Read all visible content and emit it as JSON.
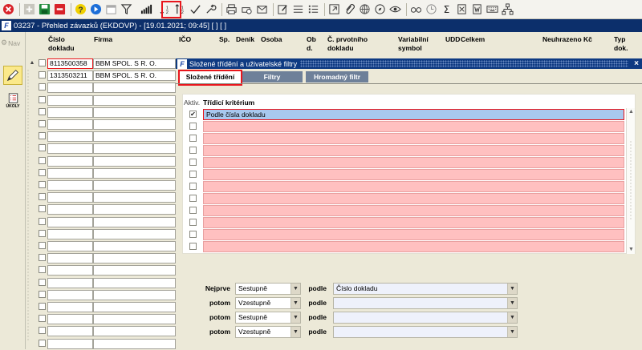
{
  "window": {
    "title": "03237 - Přehled závazků (EKDOVP) - [19.01.2021; 09:45]  [ ]  [ ]"
  },
  "sidebar": {
    "nav_label": "Nav",
    "ukoly_label": "ÚKOLY"
  },
  "columns": [
    {
      "key": "cislo",
      "label": "Číslo\ndokladu"
    },
    {
      "key": "firma",
      "label": "Firma"
    },
    {
      "key": "ico",
      "label": "IČO"
    },
    {
      "key": "sp",
      "label": "Sp."
    },
    {
      "key": "denik",
      "label": "Deník"
    },
    {
      "key": "osoba",
      "label": "Osoba"
    },
    {
      "key": "ob",
      "label": "Ob\nd."
    },
    {
      "key": "cprv",
      "label": "Č. prvotního\ndokladu"
    },
    {
      "key": "var",
      "label": "Variabilní\nsymbol"
    },
    {
      "key": "udd",
      "label": "UDD"
    },
    {
      "key": "celkem",
      "label": "Celkem"
    },
    {
      "key": "neuhr",
      "label": "Neuhrazeno Kč"
    },
    {
      "key": "typ",
      "label": "Typ\ndok."
    }
  ],
  "rows": [
    {
      "cislo": "8113500358",
      "firma": "BBM SPOL. S R. O."
    },
    {
      "cislo": "1313503211",
      "firma": "BBM SPOL. S R. O."
    }
  ],
  "panel": {
    "title": "Složené třídění a uživatelské filtry",
    "close": "×",
    "tabs": [
      "Složené třídění",
      "Filtry",
      "Hromadný filtr"
    ],
    "aktiv_label": "Aktiv.",
    "criterion_label": "Třídicí kritérium",
    "criteria": [
      "Podle čísla dokladu",
      "",
      "",
      "",
      "",
      "",
      "",
      "",
      "",
      "",
      "",
      ""
    ],
    "first_checked": "✔",
    "sort": [
      {
        "label": "Nejprve",
        "order": "Sestupně",
        "podle": "podle",
        "field": "Číslo dokladu"
      },
      {
        "label": "potom",
        "order": "Vzestupně",
        "podle": "podle",
        "field": ""
      },
      {
        "label": "potom",
        "order": "Sestupně",
        "podle": "podle",
        "field": ""
      },
      {
        "label": "potom",
        "order": "Vzestupně",
        "podle": "podle",
        "field": ""
      }
    ]
  },
  "colors": {
    "accent": "#0c2f6b",
    "highlight_red": "#e8161c",
    "criteria_pink": "#ffc0c0",
    "selected_blue": "#a8c8ee",
    "tab_inactive": "#6e8099"
  },
  "icons": [
    "close-circle-icon",
    "add-icon",
    "save-icon",
    "delete-icon",
    "help-icon",
    "play-icon",
    "calendar-icon",
    "filter-icon",
    "signal-bars-icon",
    "sort-asc-icon",
    "sort-desc-icon",
    "check-icon",
    "wrench-icon",
    "print-icon",
    "print-preview-icon",
    "mail-icon",
    "edit-icon",
    "list-icon",
    "checklist-icon",
    "external-icon",
    "paperclip-icon",
    "globe-icon",
    "compass-icon",
    "eye-icon",
    "glasses-icon",
    "clock-icon",
    "sigma-icon",
    "excel-icon",
    "word-icon",
    "keyboard-icon",
    "tree-icon"
  ]
}
